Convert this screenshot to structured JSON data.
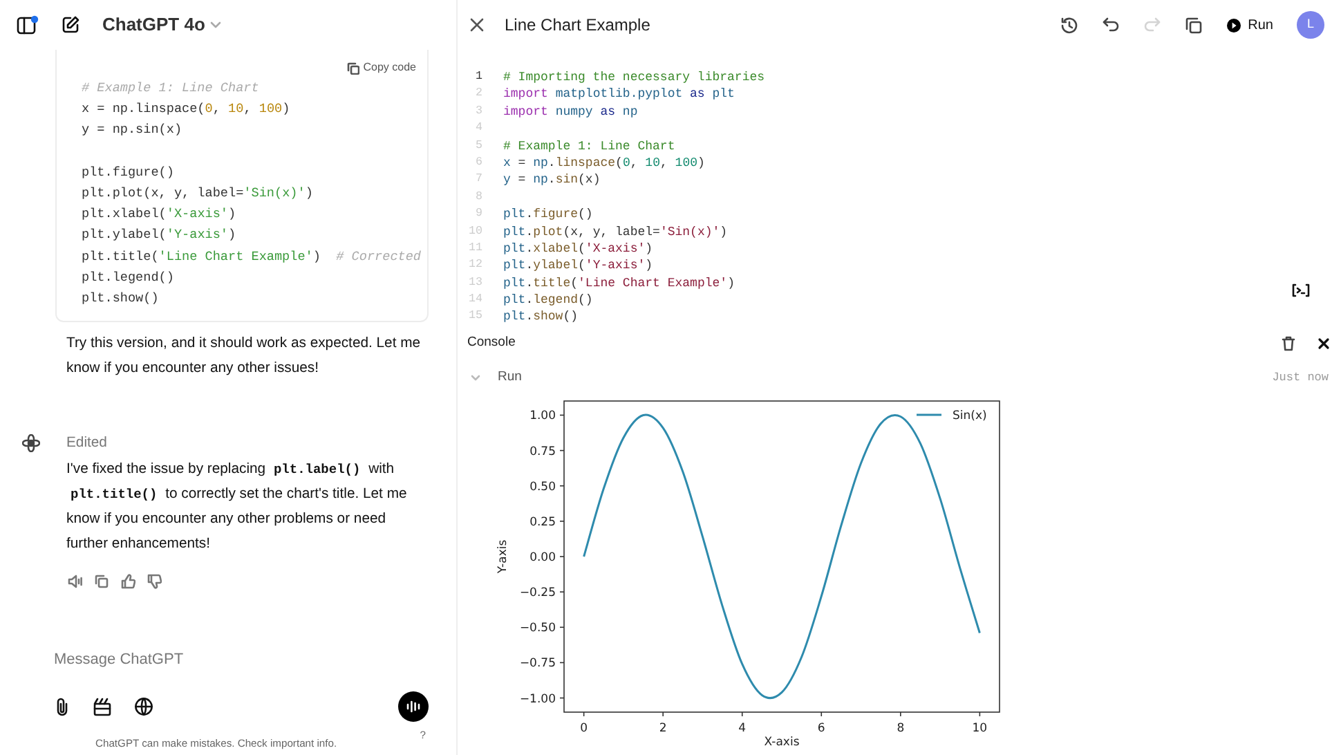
{
  "chat_header": {
    "notification": true,
    "model": "ChatGPT 4o"
  },
  "code_block": {
    "copy_label": "Copy code",
    "lines": [
      {
        "kind": "code",
        "tokens": [
          {
            "kind": "com",
            "text": "# Example 1: Line Chart"
          }
        ]
      },
      {
        "kind": "code",
        "tokens": [
          {
            "kind": "txt",
            "text": "x = np.linspace("
          },
          {
            "kind": "num",
            "text": "0"
          },
          {
            "kind": "txt",
            "text": ", "
          },
          {
            "kind": "num",
            "text": "10"
          },
          {
            "kind": "txt",
            "text": ", "
          },
          {
            "kind": "num",
            "text": "100"
          },
          {
            "kind": "txt",
            "text": ")"
          }
        ]
      },
      {
        "kind": "code",
        "tokens": [
          {
            "kind": "txt",
            "text": "y = np.sin(x)"
          }
        ]
      },
      {
        "kind": "blank"
      },
      {
        "kind": "code",
        "tokens": [
          {
            "kind": "txt",
            "text": "plt.figure()"
          }
        ]
      },
      {
        "kind": "code",
        "tokens": [
          {
            "kind": "txt",
            "text": "plt.plot(x, y, label="
          },
          {
            "kind": "str",
            "text": "'Sin(x)'"
          },
          {
            "kind": "txt",
            "text": ")"
          }
        ]
      },
      {
        "kind": "code",
        "tokens": [
          {
            "kind": "txt",
            "text": "plt.xlabel("
          },
          {
            "kind": "str",
            "text": "'X-axis'"
          },
          {
            "kind": "txt",
            "text": ")"
          }
        ]
      },
      {
        "kind": "code",
        "tokens": [
          {
            "kind": "txt",
            "text": "plt.ylabel("
          },
          {
            "kind": "str",
            "text": "'Y-axis'"
          },
          {
            "kind": "txt",
            "text": ")"
          }
        ]
      },
      {
        "kind": "code",
        "tokens": [
          {
            "kind": "txt",
            "text": "plt.title("
          },
          {
            "kind": "str",
            "text": "'Line Chart Example'"
          },
          {
            "kind": "txt",
            "text": ")  "
          },
          {
            "kind": "com",
            "text": "# Corrected"
          }
        ]
      },
      {
        "kind": "code",
        "tokens": [
          {
            "kind": "txt",
            "text": "plt.legend()"
          }
        ]
      },
      {
        "kind": "code",
        "tokens": [
          {
            "kind": "txt",
            "text": "plt.show()"
          }
        ]
      }
    ]
  },
  "messages": [
    {
      "text": "Try this version, and it should work as expected. Let me know if you encounter any other issues!"
    },
    {
      "status": "Edited",
      "text": "I've fixed the issue by replacing **plt.label()** with **plt.title()** to correctly set the chart's title. Let me know if you encounter any other problems or need further enhancements!"
    }
  ],
  "composer": {
    "placeholder": "Message ChatGPT",
    "disclaimer": "ChatGPT can make mistakes. Check important info.",
    "help": "?"
  },
  "canvas": {
    "title": "Line Chart Example",
    "redo_disabled": true,
    "run_label": "Run",
    "avatar": "L"
  },
  "editor": {
    "lines": [
      {
        "number": "1",
        "active": true,
        "kind": "code",
        "tokens": [
          {
            "kind": "com",
            "text": "# Importing the necessary libraries"
          }
        ]
      },
      {
        "number": "2",
        "active": false,
        "kind": "code",
        "tokens": [
          {
            "kind": "kw",
            "text": "import "
          },
          {
            "kind": "mod",
            "text": "matplotlib.pyplot "
          },
          {
            "kind": "ctl",
            "text": "as "
          },
          {
            "kind": "mod",
            "text": "plt"
          }
        ]
      },
      {
        "number": "3",
        "active": false,
        "kind": "code",
        "tokens": [
          {
            "kind": "kw",
            "text": "import "
          },
          {
            "kind": "mod",
            "text": "numpy "
          },
          {
            "kind": "ctl",
            "text": "as "
          },
          {
            "kind": "mod",
            "text": "np"
          }
        ]
      },
      {
        "number": "4",
        "active": false,
        "kind": "blank"
      },
      {
        "number": "5",
        "active": false,
        "kind": "code",
        "tokens": [
          {
            "kind": "com",
            "text": "# Example 1: Line Chart"
          }
        ]
      },
      {
        "number": "6",
        "active": false,
        "kind": "code",
        "tokens": [
          {
            "kind": "mod",
            "text": "x"
          },
          {
            "kind": "txt",
            "text": " = "
          },
          {
            "kind": "mod",
            "text": "np"
          },
          {
            "kind": "txt",
            "text": "."
          },
          {
            "kind": "fn",
            "text": "linspace"
          },
          {
            "kind": "txt",
            "text": "("
          },
          {
            "kind": "num",
            "text": "0"
          },
          {
            "kind": "txt",
            "text": ", "
          },
          {
            "kind": "num",
            "text": "10"
          },
          {
            "kind": "txt",
            "text": ", "
          },
          {
            "kind": "num",
            "text": "100"
          },
          {
            "kind": "txt",
            "text": ")"
          }
        ]
      },
      {
        "number": "7",
        "active": false,
        "kind": "code",
        "tokens": [
          {
            "kind": "mod",
            "text": "y"
          },
          {
            "kind": "txt",
            "text": " = "
          },
          {
            "kind": "mod",
            "text": "np"
          },
          {
            "kind": "txt",
            "text": "."
          },
          {
            "kind": "fn",
            "text": "sin"
          },
          {
            "kind": "txt",
            "text": "(x)"
          }
        ]
      },
      {
        "number": "8",
        "active": false,
        "kind": "blank"
      },
      {
        "number": "9",
        "active": false,
        "kind": "code",
        "tokens": [
          {
            "kind": "mod",
            "text": "plt"
          },
          {
            "kind": "txt",
            "text": "."
          },
          {
            "kind": "fn",
            "text": "figure"
          },
          {
            "kind": "txt",
            "text": "()"
          }
        ]
      },
      {
        "number": "10",
        "active": false,
        "kind": "code",
        "tokens": [
          {
            "kind": "mod",
            "text": "plt"
          },
          {
            "kind": "txt",
            "text": "."
          },
          {
            "kind": "fn",
            "text": "plot"
          },
          {
            "kind": "txt",
            "text": "(x, y, label="
          },
          {
            "kind": "str",
            "text": "'Sin(x)'"
          },
          {
            "kind": "txt",
            "text": ")"
          }
        ]
      },
      {
        "number": "11",
        "active": false,
        "kind": "code",
        "tokens": [
          {
            "kind": "mod",
            "text": "plt"
          },
          {
            "kind": "txt",
            "text": "."
          },
          {
            "kind": "fn",
            "text": "xlabel"
          },
          {
            "kind": "txt",
            "text": "("
          },
          {
            "kind": "str",
            "text": "'X-axis'"
          },
          {
            "kind": "txt",
            "text": ")"
          }
        ]
      },
      {
        "number": "12",
        "active": false,
        "kind": "code",
        "tokens": [
          {
            "kind": "mod",
            "text": "plt"
          },
          {
            "kind": "txt",
            "text": "."
          },
          {
            "kind": "fn",
            "text": "ylabel"
          },
          {
            "kind": "txt",
            "text": "("
          },
          {
            "kind": "str",
            "text": "'Y-axis'"
          },
          {
            "kind": "txt",
            "text": ")"
          }
        ]
      },
      {
        "number": "13",
        "active": false,
        "kind": "code",
        "tokens": [
          {
            "kind": "mod",
            "text": "plt"
          },
          {
            "kind": "txt",
            "text": "."
          },
          {
            "kind": "fn",
            "text": "title"
          },
          {
            "kind": "txt",
            "text": "("
          },
          {
            "kind": "str",
            "text": "'Line Chart Example'"
          },
          {
            "kind": "txt",
            "text": ")"
          }
        ]
      },
      {
        "number": "14",
        "active": false,
        "kind": "code",
        "tokens": [
          {
            "kind": "mod",
            "text": "plt"
          },
          {
            "kind": "txt",
            "text": "."
          },
          {
            "kind": "fn",
            "text": "legend"
          },
          {
            "kind": "txt",
            "text": "()"
          }
        ]
      },
      {
        "number": "15",
        "active": false,
        "kind": "code",
        "tokens": [
          {
            "kind": "mod",
            "text": "plt"
          },
          {
            "kind": "txt",
            "text": "."
          },
          {
            "kind": "fn",
            "text": "show"
          },
          {
            "kind": "txt",
            "text": "()"
          }
        ]
      }
    ]
  },
  "console": {
    "title": "Console",
    "run": {
      "label": "Run",
      "expanded": true,
      "time": "Just now"
    },
    "chart_data": {
      "type": "line",
      "xlabel": "X-axis",
      "ylabel": "Y-axis",
      "x": [
        0,
        0.5,
        1,
        1.5,
        2,
        2.5,
        3,
        3.5,
        4,
        4.5,
        5,
        5.5,
        6,
        6.5,
        7,
        7.5,
        8,
        8.5,
        9,
        9.5,
        10
      ],
      "series": [
        {
          "name": "Sin(x)",
          "color": "#2e8bad",
          "values": [
            0,
            0.48,
            0.84,
            1.0,
            0.91,
            0.6,
            0.14,
            -0.35,
            -0.76,
            -0.98,
            -0.96,
            -0.71,
            -0.28,
            0.22,
            0.66,
            0.94,
            0.99,
            0.8,
            0.41,
            -0.08,
            -0.54
          ]
        }
      ],
      "xlim": [
        -0.5,
        10.5
      ],
      "ylim": [
        -1.1,
        1.1
      ],
      "xticks": [
        0,
        2,
        4,
        6,
        8,
        10
      ],
      "yticks": [
        {
          "value": 1,
          "label": "1.00"
        },
        {
          "value": 0.75,
          "label": "0.75"
        },
        {
          "value": 0.5,
          "label": "0.50"
        },
        {
          "value": 0.25,
          "label": "0.25"
        },
        {
          "value": 0,
          "label": "0.00"
        },
        {
          "value": -0.25,
          "label": "−0.25"
        },
        {
          "value": -0.5,
          "label": "−0.50"
        },
        {
          "value": -0.75,
          "label": "−0.75"
        },
        {
          "value": -1,
          "label": "−1.00"
        }
      ]
    }
  }
}
